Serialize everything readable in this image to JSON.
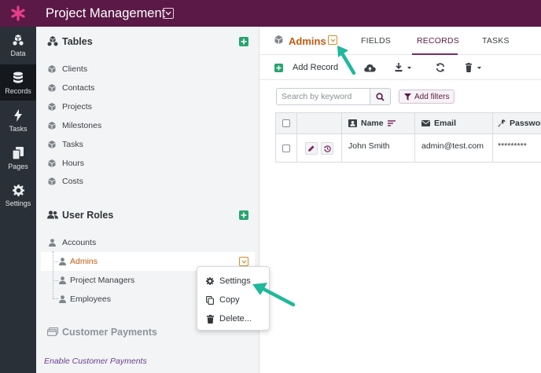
{
  "app": {
    "title": "Project Management"
  },
  "nav": {
    "items": [
      {
        "label": "Data",
        "icon": "data-icon",
        "active": false
      },
      {
        "label": "Records",
        "icon": "database-icon",
        "active": true
      },
      {
        "label": "Tasks",
        "icon": "lightning-icon",
        "active": false
      },
      {
        "label": "Pages",
        "icon": "pages-icon",
        "active": false
      },
      {
        "label": "Settings",
        "icon": "gear-icon",
        "active": false
      }
    ]
  },
  "sidebar": {
    "tables_title": "Tables",
    "tables": [
      "Clients",
      "Contacts",
      "Projects",
      "Milestones",
      "Tasks",
      "Hours",
      "Costs"
    ],
    "roles_title": "User Roles",
    "roles": [
      "Accounts",
      "Admins",
      "Project Managers",
      "Employees"
    ],
    "selected_role": "Admins",
    "payments_title": "Customer Payments",
    "payments_link": "Enable Customer Payments"
  },
  "context_menu": {
    "items": [
      "Settings",
      "Copy",
      "Delete..."
    ]
  },
  "main": {
    "object_name": "Admins",
    "tabs": [
      "FIELDS",
      "RECORDS",
      "TASKS"
    ],
    "active_tab": "RECORDS",
    "toolbar": {
      "add_record": "Add Record"
    },
    "search": {
      "placeholder": "Search by keyword"
    },
    "filter_label": "Add filters",
    "table": {
      "columns": [
        "Name",
        "Email",
        "Password"
      ],
      "rows": [
        {
          "name": "John Smith",
          "email": "admin@test.com",
          "password": "*********"
        }
      ]
    }
  },
  "colors": {
    "topbar": "#5b1947",
    "accent_orange": "#c55a11",
    "add_green": "#27a46e",
    "arrow_teal": "#1fb89a"
  }
}
